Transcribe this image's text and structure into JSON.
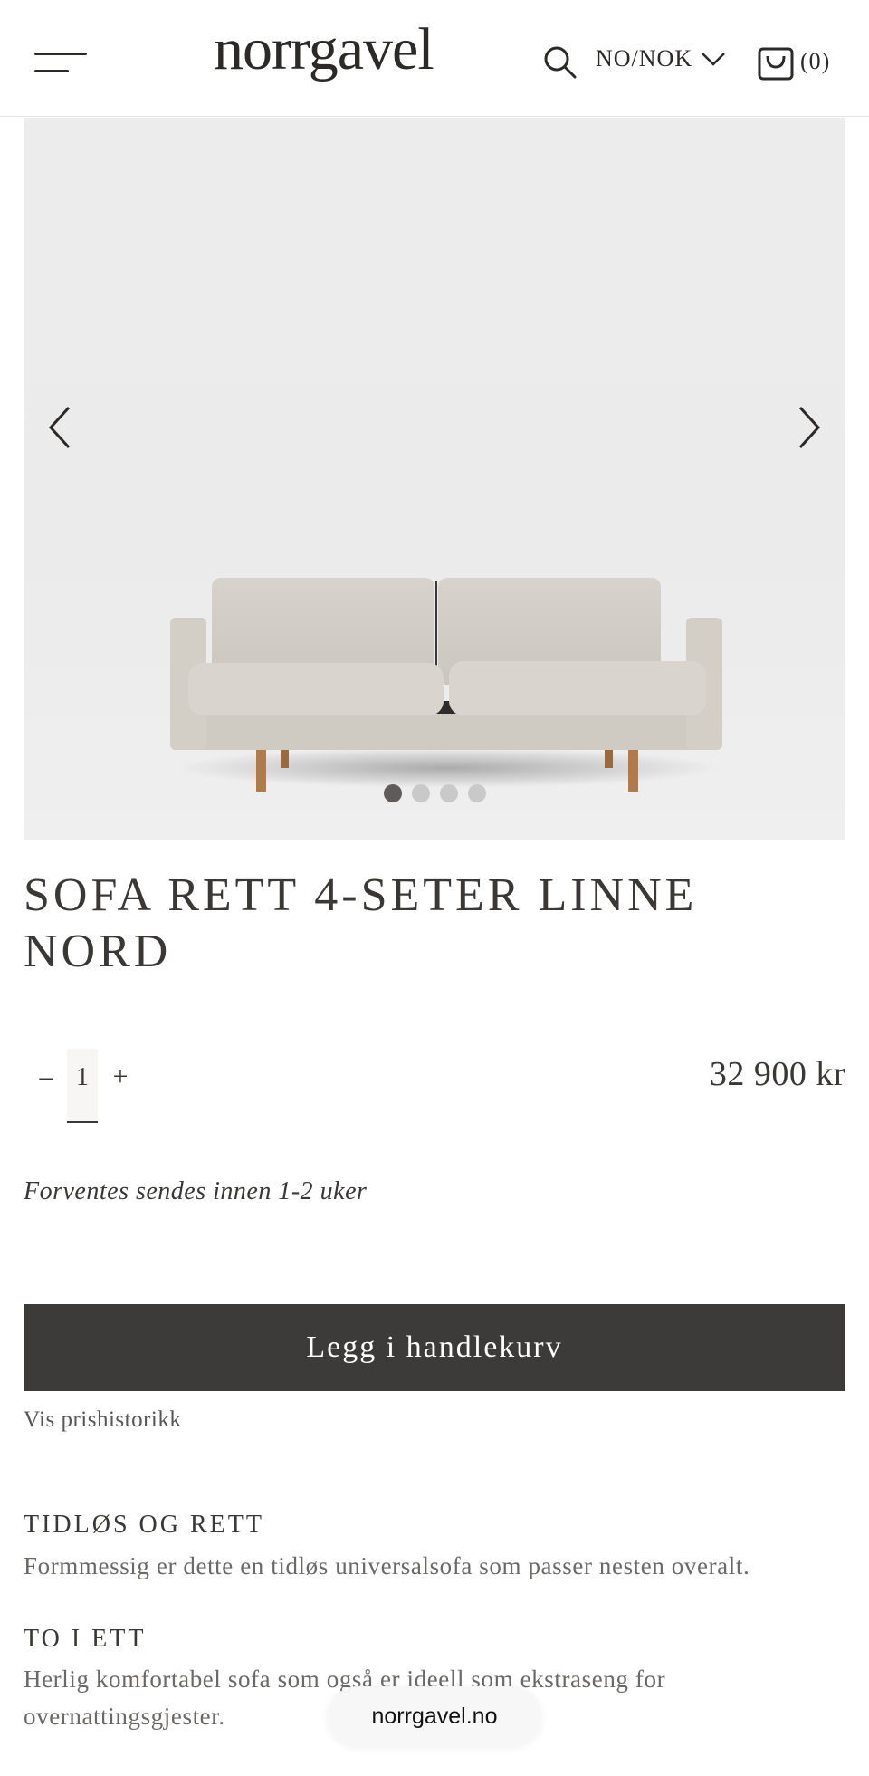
{
  "header": {
    "logo": "norrgavel",
    "locale": "NO/NOK",
    "cart_count": "(0)"
  },
  "gallery": {
    "image_count": 4,
    "active_index": 0
  },
  "product": {
    "title": "SOFA RETT 4-SETER LINNE NORD",
    "quantity": "1",
    "qty_minus": "–",
    "qty_plus": "+",
    "price": "32 900 kr",
    "shipping": "Forventes sendes innen 1-2 uker",
    "add_to_cart": "Legg i handlekurv",
    "price_history": "Vis prishistorikk"
  },
  "sections": [
    {
      "heading": "TIDLØS OG RETT",
      "text": "Formmessig er dette en tidløs universalsofa som passer nesten overalt."
    },
    {
      "heading": "TO I ETT",
      "text": "Herlig komfortabel sofa som også er ideell som ekstraseng for overnattingsgjester."
    }
  ],
  "browser": {
    "url": "norrgavel.no"
  },
  "colors": {
    "button_bg": "#3c3b39",
    "text": "#3a3836",
    "dot_active": "#5d5c5a",
    "dot_inactive": "#c9c9c9"
  }
}
